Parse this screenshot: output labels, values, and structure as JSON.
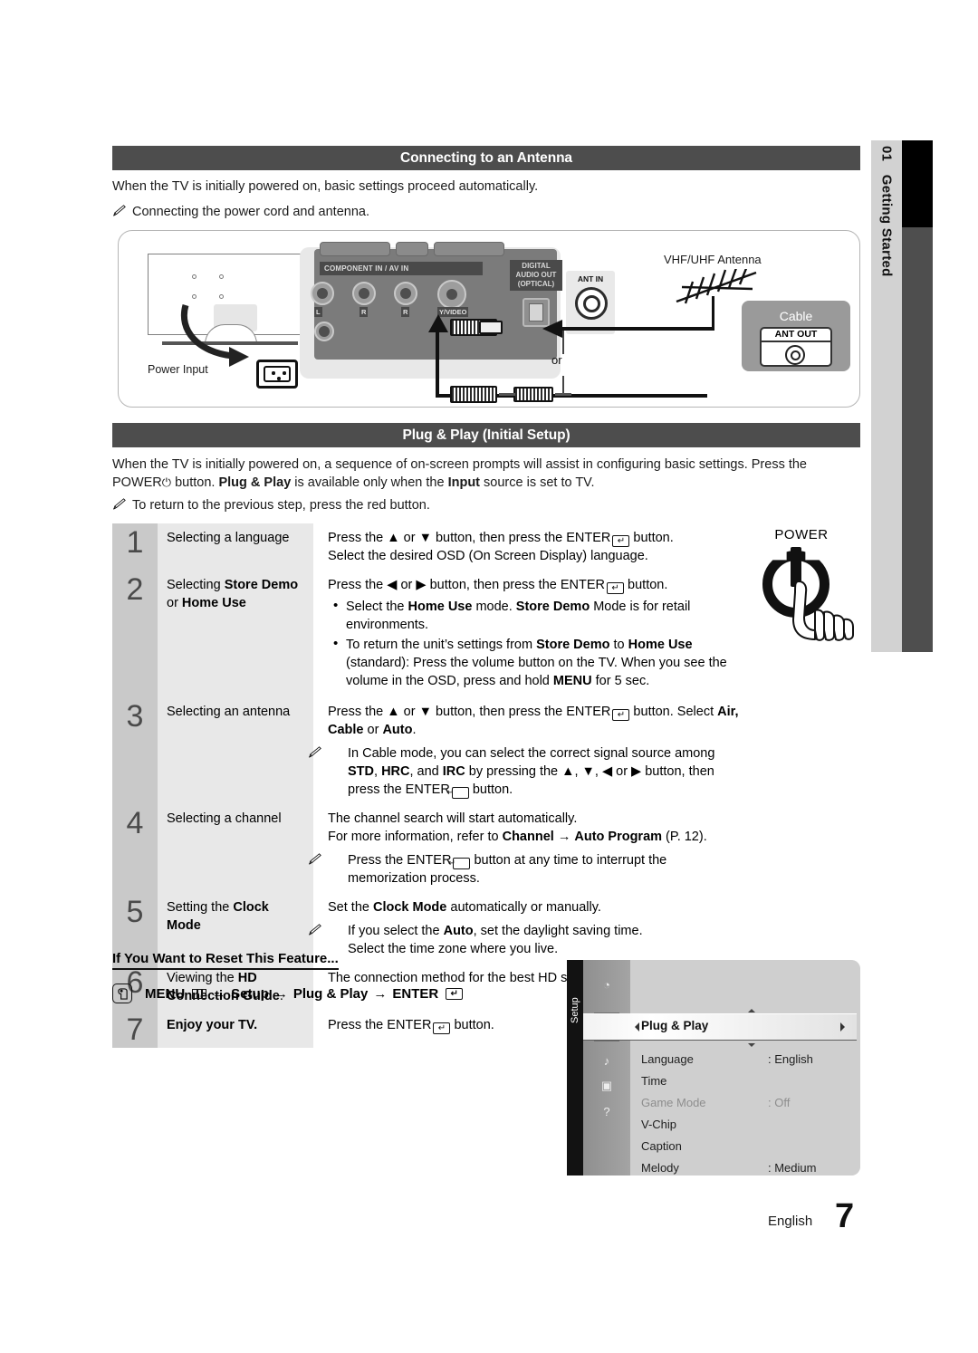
{
  "sidebar": {
    "chapter_number": "01",
    "chapter_title": "Getting Started"
  },
  "sections": {
    "antenna": {
      "heading": "Connecting to an Antenna",
      "intro": "When the TV is initially powered on, basic settings proceed automatically.",
      "note": "Connecting the power cord and antenna."
    },
    "plugplay": {
      "heading": "Plug & Play (Initial Setup)",
      "intro_part1": "When the TV is initially powered on, a sequence of on-screen prompts will assist in configuring basic settings. Press the ",
      "intro_power": "POWER",
      "intro_part2": " button. ",
      "intro_bold1": "Plug & Play",
      "intro_part3": " is available only when the ",
      "intro_bold2": "Input",
      "intro_part4": " source is set to TV.",
      "note": "To return to the previous step, press the red button."
    }
  },
  "diagram": {
    "power_input_label": "Power Input",
    "component_label": "COMPONENT IN / AV IN",
    "digital_audio_label_l1": "DIGITAL",
    "digital_audio_label_l2": "AUDIO OUT",
    "digital_audio_label_l3": "(OPTICAL)",
    "ant_in_label": "ANT IN",
    "rca_labels": [
      "L",
      "R",
      "R",
      "Y/VIDEO"
    ],
    "antenna_label": "VHF/UHF Antenna",
    "or_label": "or",
    "cable_label": "Cable",
    "ant_out_label": "ANT OUT"
  },
  "power_illustration": {
    "label": "POWER"
  },
  "steps": [
    {
      "number": "1",
      "title_plain": "Selecting a language",
      "desc_line1_a": "Press the ",
      "desc_line1_arrows": "▲ or ▼",
      "desc_line1_b": " button, then press the ENTER",
      "desc_line1_c": " button.",
      "desc_line2": "Select the desired OSD (On Screen Display) language."
    },
    {
      "number": "2",
      "title_a": "Selecting ",
      "title_bold1": "Store Demo",
      "title_b": "or ",
      "title_bold2": "Home Use",
      "desc_line1_a": "Press the ",
      "desc_line1_arrows": "◀ or ▶",
      "desc_line1_b": " button, then press the ENTER",
      "desc_line1_c": " button.",
      "bullet1_a": "Select the ",
      "bullet1_b1": "Home Use",
      "bullet1_b": " mode. ",
      "bullet1_b2": "Store Demo",
      "bullet1_c": " Mode is for retail environments.",
      "bullet2_a": "To return the unit’s settings from ",
      "bullet2_b1": "Store Demo",
      "bullet2_b": " to ",
      "bullet2_b2": "Home Use",
      "bullet2_c": " (standard): Press the volume button on the TV. When you see the volume in the OSD, press and hold ",
      "bullet2_b3": "MENU",
      "bullet2_d": " for 5 sec."
    },
    {
      "number": "3",
      "title_plain": "Selecting an antenna",
      "desc_line1_a": "Press the ",
      "desc_line1_arrows": "▲ or ▼",
      "desc_line1_b": " button, then press the ENTER",
      "desc_line1_c": " button. Select ",
      "desc_line1_bold": "Air, Cable",
      "desc_line1_d": " or ",
      "desc_line1_bold2": "Auto",
      "desc_line1_e": ".",
      "note_a": "In Cable mode, you can select the correct signal source among ",
      "note_b1": "STD",
      "note_b": ", ",
      "note_b2": "HRC",
      "note_c": ", and ",
      "note_b3": "IRC",
      "note_d": " by pressing the ▲, ▼, ◀ or ▶ button, then press the ENTER",
      "note_e": " button."
    },
    {
      "number": "4",
      "title_plain": "Selecting a channel",
      "desc_line1": "The channel search will start automatically.",
      "desc_line2_a": "For more information, refer to ",
      "desc_line2_b1": "Channel",
      "desc_line2_arrow": " → ",
      "desc_line2_b2": "Auto Program",
      "desc_line2_c": " (P. 12).",
      "note_a": "Press the ENTER",
      "note_b": " button at any time to interrupt the memorization process."
    },
    {
      "number": "5",
      "title_a": "Setting the ",
      "title_bold1": "Clock",
      "title_bold2": "Mode",
      "desc_line1_a": "Set the ",
      "desc_line1_b1": "Clock Mode",
      "desc_line1_b": " automatically or manually.",
      "note_a": "If you select the ",
      "note_b1": "Auto",
      "note_b": ", set the daylight saving time.",
      "note_line2": "Select the time zone where you live."
    },
    {
      "number": "6",
      "title_a": "Viewing the ",
      "title_bold1": "HD",
      "title_bold2": "Connection Guide",
      "title_b": ".",
      "desc_line1": "The connection method for the best HD screen quality is displayed."
    },
    {
      "number": "7",
      "title_bold_all": "Enjoy your TV.",
      "desc_line1_a": "Press the ENTER",
      "desc_line1_b": " button."
    }
  ],
  "reset": {
    "title": "If You Want to Reset This Feature...",
    "path_menu": "MENU",
    "path_arrow1": "→",
    "path_setup": "Setup",
    "path_arrow2": "→",
    "path_plugplay": "Plug & Play",
    "path_arrow3": "→",
    "path_enter": "ENTER"
  },
  "osd": {
    "rail_label": "Setup",
    "highlight_item": "Plug & Play",
    "items": [
      {
        "label": "Language",
        "value": ": English",
        "dim": false
      },
      {
        "label": "Time",
        "value": "",
        "dim": false
      },
      {
        "label": "Game Mode",
        "value": ": Off",
        "dim": true
      },
      {
        "label": "V-Chip",
        "value": "",
        "dim": false
      },
      {
        "label": "Caption",
        "value": "",
        "dim": false
      },
      {
        "label": "Melody",
        "value": ": Medium",
        "dim": false
      }
    ]
  },
  "footer": {
    "language": "English",
    "page_number": "7"
  },
  "colors": {
    "section_header_bg": "#4d4d4d",
    "step_number_bg": "#c9c9c9",
    "step_title_bg": "#e8e8e8",
    "sidebar_bg": "#d2d2d2"
  }
}
